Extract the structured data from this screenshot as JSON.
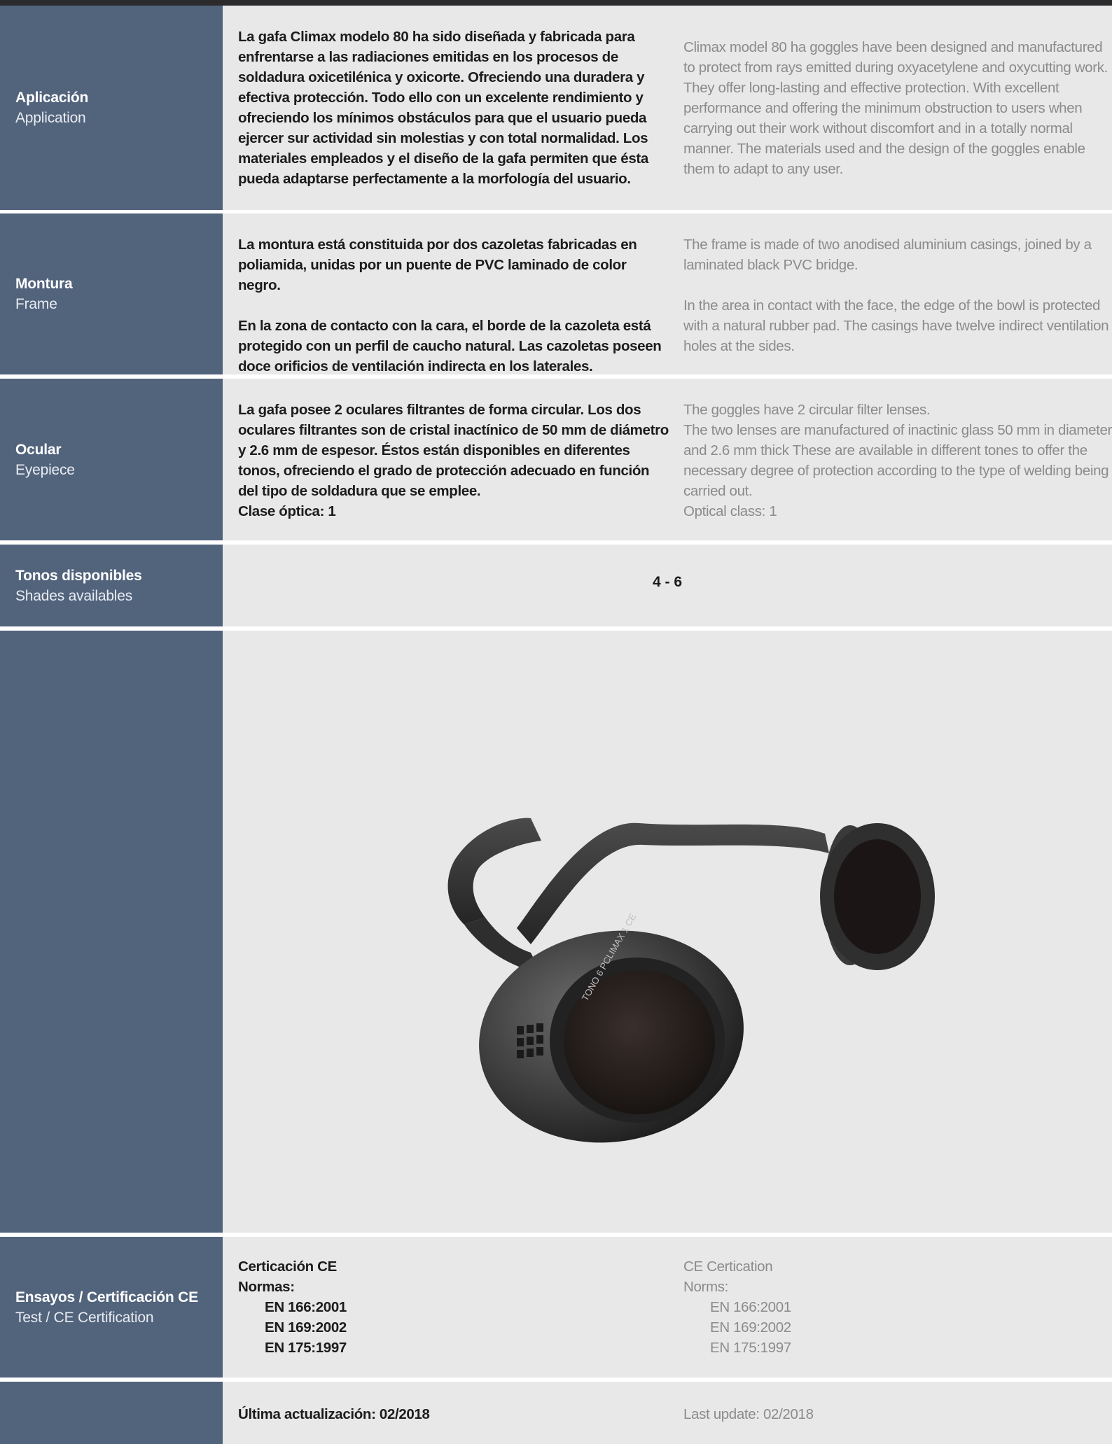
{
  "rows": {
    "application": {
      "label_es": "Aplicación",
      "label_en": "Application",
      "text_es": "La gafa Climax modelo 80 ha sido diseñada y fabricada para enfrentarse a las radiaciones emitidas en los procesos de soldadura oxicetilénica y oxicorte. Ofreciendo una duradera y efectiva protección. Todo ello con un excelente rendimiento y ofreciendo los mínimos obstáculos para que el usuario pueda ejercer sur actividad sin molestias y con total normalidad. Los materiales empleados y el diseño de la gafa permiten que ésta pueda adaptarse perfectamente a la morfología del usuario.",
      "text_en": "Climax model 80 ha goggles have been designed and manufactured to protect from rays emitted during oxyacetylene and oxycutting work. They offer long-lasting and effective protection. With excellent performance and offering the minimum obstruction to users when carrying out their work without discomfort and in a totally normal manner. The materials used and the design of the goggles enable them to adapt to any user."
    },
    "frame": {
      "label_es": "Montura",
      "label_en": "Frame",
      "text_es_1": "La montura está constituida por dos cazoletas fabricadas en poliamida, unidas por un puente de PVC laminado de color negro.",
      "text_es_2": "En la zona de contacto con la cara, el borde de la cazoleta está protegido con un perfil de caucho natural. Las cazoletas poseen doce orificios de ventilación indirecta en los laterales.",
      "text_en_1": "The frame is made of two anodised aluminium casings, joined by a laminated black PVC bridge.",
      "text_en_2": "In the area in contact with the face, the edge of the bowl is protected with a natural rubber pad. The casings have twelve indirect ventilation holes at the sides."
    },
    "eyepiece": {
      "label_es": "Ocular",
      "label_en": "Eyepiece",
      "text_es": "La gafa posee 2 oculares filtrantes de forma circular. Los dos oculares filtrantes son de cristal inactínico de 50 mm de diámetro y 2.6 mm de espesor. Éstos están disponibles en diferentes tonos, ofreciendo el grado de protección adecuado en función del tipo de soldadura que se emplee.",
      "text_es_class": "Clase óptica: 1",
      "text_en_1": "The goggles have 2 circular filter lenses.",
      "text_en_2": "The two lenses are manufactured of inactinic glass 50 mm in diameter and 2.6 mm thick These are available in different tones to offer the necessary degree of protection according to the type of welding being carried out.",
      "text_en_class": "Optical class: 1"
    },
    "shades": {
      "label_es": "Tonos disponibles",
      "label_en": "Shades availables",
      "value": "4 - 6"
    },
    "photo": {
      "lens_print": "TONO 6 PCLIMAX 1 CE"
    },
    "certification": {
      "label_es": "Ensayos / Certificación CE",
      "label_en": "Test / CE Certification",
      "title_es": "Certicación CE",
      "norms_es": "Normas:",
      "title_en": "CE Certication",
      "norms_en": "Norms:",
      "standards": [
        "EN 166:2001",
        "EN 169:2002",
        "EN 175:1997"
      ]
    },
    "update": {
      "text_es": "Última actualización: 02/2018",
      "text_en": "Last update: 02/2018"
    }
  },
  "colors": {
    "sidebar": "#52637c",
    "content_bg": "#e8e8e8",
    "top_bar": "#2b2b2d",
    "text_dark": "#1c1c1c",
    "text_grey": "#8b8b8b"
  }
}
